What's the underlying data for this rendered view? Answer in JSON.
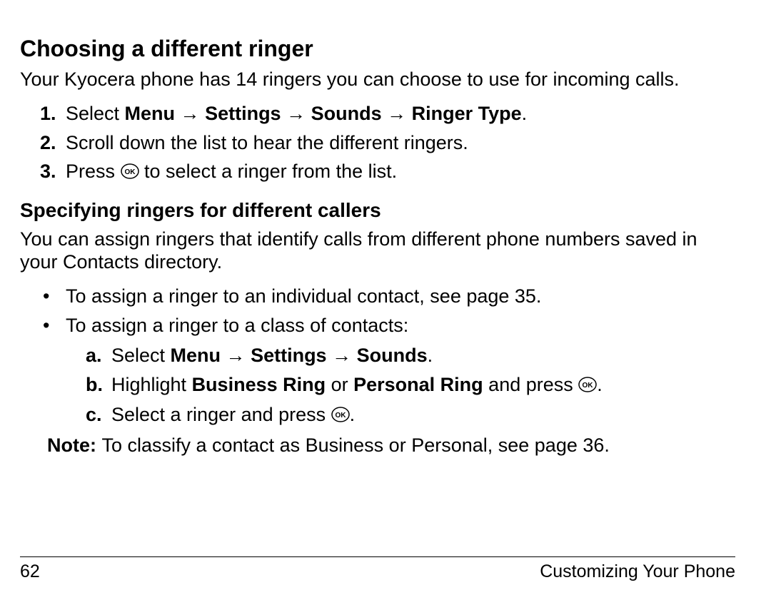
{
  "heading_main": "Choosing a different ringer",
  "intro_main": "Your Kyocera phone has 14 ringers you can choose to use for incoming calls.",
  "steps": {
    "s1_num": "1.",
    "s1_prefix": "Select ",
    "s1_path_menu": "Menu",
    "s1_path_settings": "Settings",
    "s1_path_sounds": "Sounds",
    "s1_path_ringer_type": "Ringer Type",
    "s1_period": ".",
    "s2_num": "2.",
    "s2_text": "Scroll down the list to hear the different ringers.",
    "s3_num": "3.",
    "s3_before": "Press ",
    "s3_after": " to select a ringer from the list."
  },
  "heading_sub": "Specifying ringers for different callers",
  "intro_sub": "You can assign ringers that identify calls from different phone numbers saved in your Contacts directory.",
  "bullets": {
    "b1": "To assign a ringer to an individual contact, see page 35.",
    "b2": "To assign a ringer to a class of contacts:"
  },
  "sub_steps": {
    "a_letter": "a.",
    "a_prefix": "Select ",
    "a_menu": "Menu",
    "a_settings": "Settings",
    "a_sounds": "Sounds",
    "a_period": ".",
    "b_letter": "b.",
    "b_before": "Highlight ",
    "b_biz": "Business Ring",
    "b_or": " or ",
    "b_pers": "Personal Ring",
    "b_andpress": " and press ",
    "b_period": ".",
    "c_letter": "c.",
    "c_before": "Select a ringer and press ",
    "c_period": "."
  },
  "note": {
    "label": "Note: ",
    "text": " To classify a contact as Business or Personal, see page 36."
  },
  "arrow": " → ",
  "footer": {
    "page_number": "62",
    "section": "Customizing Your Phone"
  }
}
